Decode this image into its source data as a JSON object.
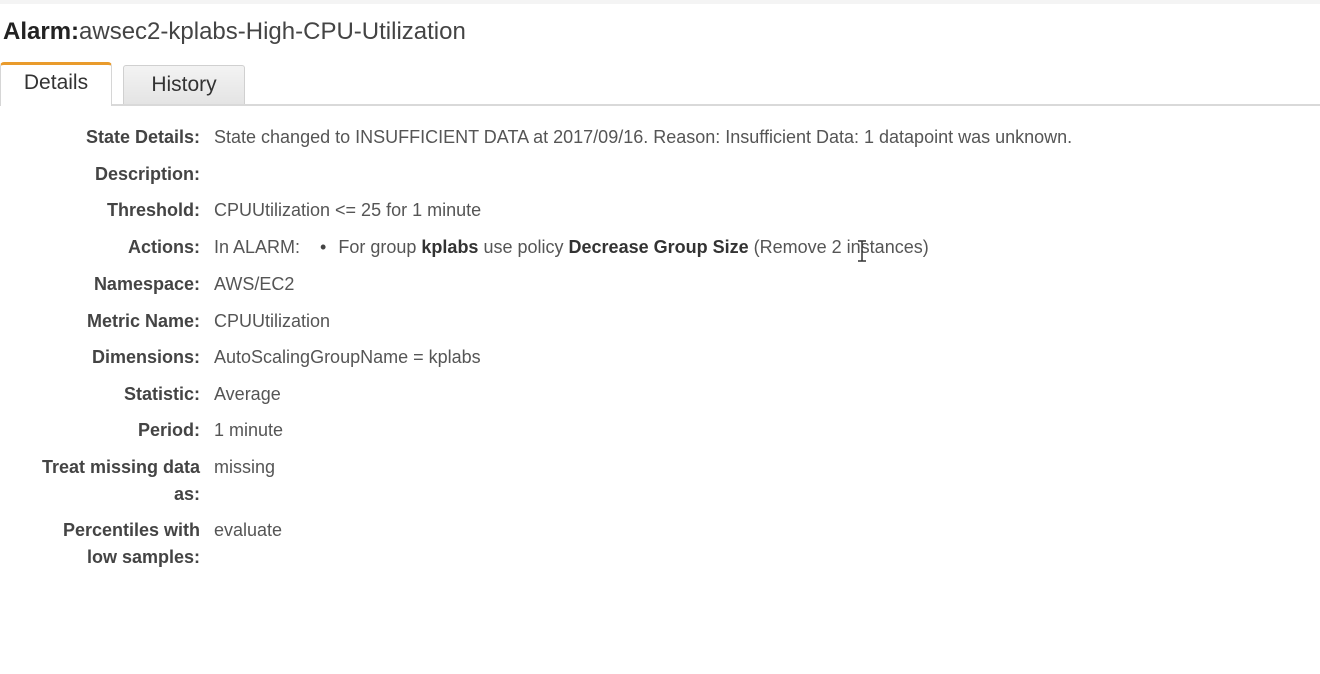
{
  "header": {
    "title_prefix": "Alarm:",
    "alarm_name": "awsec2-kplabs-High-CPU-Utilization"
  },
  "tabs": [
    {
      "label": "Details",
      "active": true
    },
    {
      "label": "History",
      "active": false
    }
  ],
  "details": {
    "state_details": {
      "label": "State Details:",
      "value": "State changed to INSUFFICIENT DATA at 2017/09/16. Reason: Insufficient Data: 1 datapoint was unknown."
    },
    "description": {
      "label": "Description:",
      "value": ""
    },
    "threshold": {
      "label": "Threshold:",
      "value": "CPUUtilization <= 25 for 1 minute"
    },
    "actions": {
      "label": "Actions:",
      "state": "In ALARM:",
      "bullet": "•",
      "text_1": "For group",
      "group": "kplabs",
      "text_2": "use policy",
      "policy": "Decrease Group Size",
      "text_3": "(Remove 2 instances)"
    },
    "namespace": {
      "label": "Namespace:",
      "value": "AWS/EC2"
    },
    "metric_name": {
      "label": "Metric Name:",
      "value": "CPUUtilization"
    },
    "dimensions": {
      "label": "Dimensions:",
      "value": "AutoScalingGroupName = kplabs"
    },
    "statistic": {
      "label": "Statistic:",
      "value": "Average"
    },
    "period": {
      "label": "Period:",
      "value": "1 minute"
    },
    "treat_missing": {
      "label_line1": "Treat missing data",
      "label_line2": "as:",
      "value": "missing"
    },
    "percentiles": {
      "label_line1": "Percentiles with",
      "label_line2": "low samples:",
      "value": "evaluate"
    }
  },
  "colors": {
    "active_tab_accent": "#e99b2c",
    "label_text": "#444444",
    "value_text": "#555555"
  }
}
